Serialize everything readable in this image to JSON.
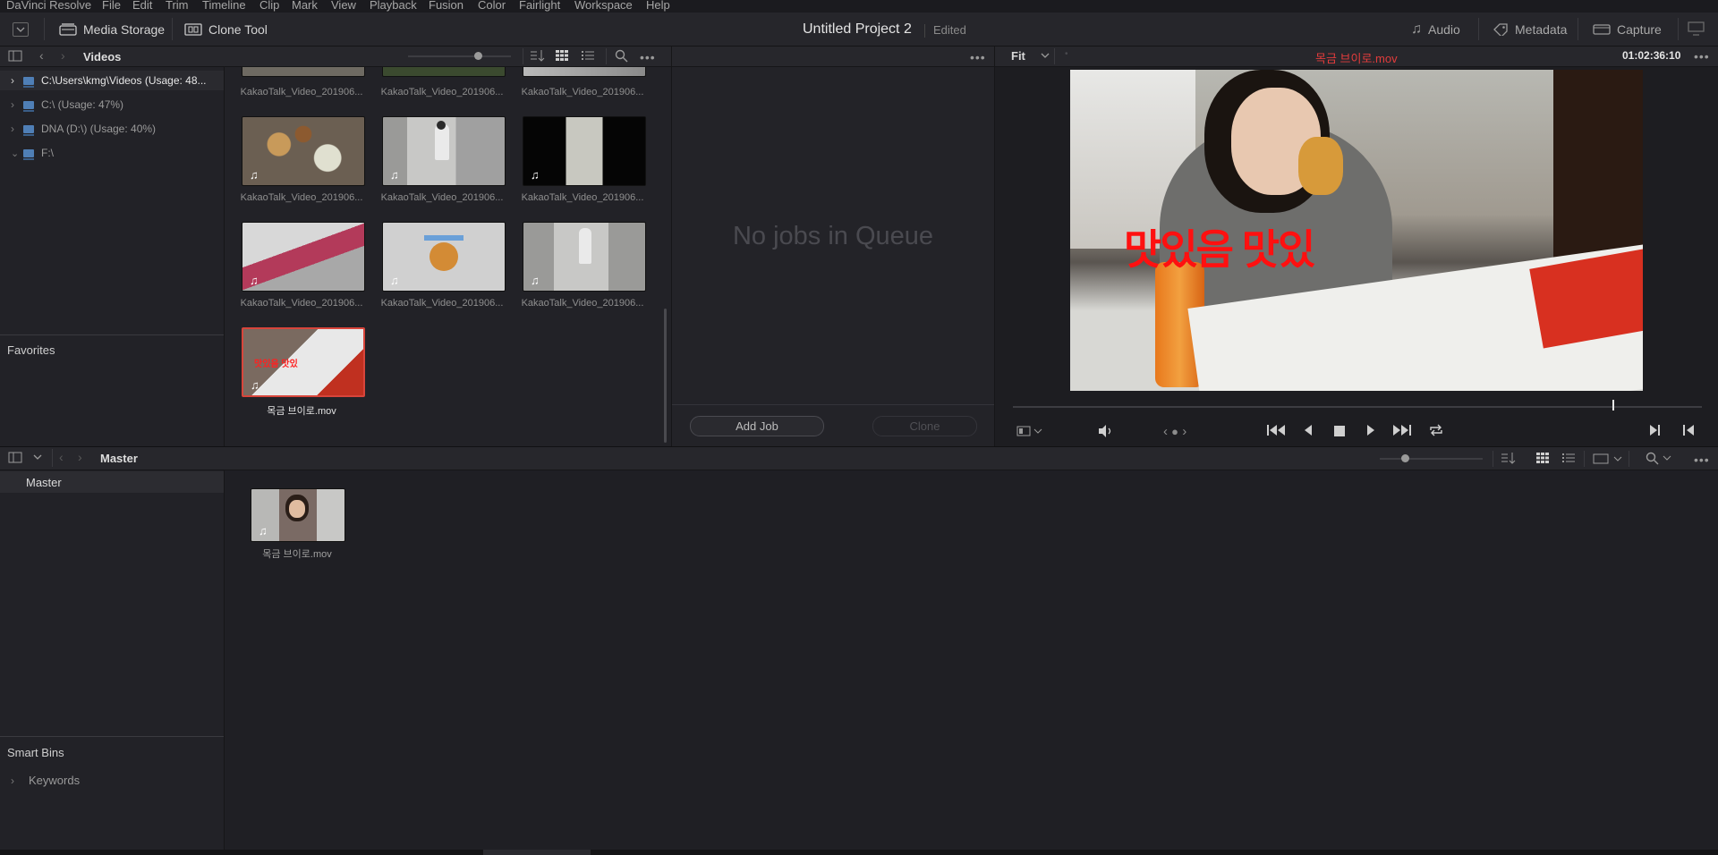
{
  "menu": [
    "DaVinci Resolve",
    "File",
    "Edit",
    "Trim",
    "Timeline",
    "Clip",
    "Mark",
    "View",
    "Playback",
    "Fusion",
    "Color",
    "Fairlight",
    "Workspace",
    "Help"
  ],
  "toolbar": {
    "media_storage": "Media Storage",
    "clone_tool": "Clone Tool",
    "project_title": "Untitled Project 2",
    "project_status": "Edited",
    "audio": "Audio",
    "metadata": "Metadata",
    "capture": "Capture"
  },
  "storage": {
    "title": "Videos",
    "tree": [
      {
        "label": "C:\\Users\\kmg\\Videos (Usage: 48...",
        "expanded": false,
        "selected": true
      },
      {
        "label": "C:\\ (Usage: 47%)",
        "expanded": false,
        "selected": false
      },
      {
        "label": "DNA (D:\\) (Usage: 40%)",
        "expanded": false,
        "selected": false
      },
      {
        "label": "F:\\",
        "expanded": true,
        "selected": false
      }
    ],
    "favorites": "Favorites"
  },
  "media_clips": [
    {
      "name": "KakaoTalk_Video_201906..."
    },
    {
      "name": "KakaoTalk_Video_201906..."
    },
    {
      "name": "KakaoTalk_Video_201906..."
    },
    {
      "name": "KakaoTalk_Video_201906..."
    },
    {
      "name": "KakaoTalk_Video_201906..."
    },
    {
      "name": "KakaoTalk_Video_201906..."
    },
    {
      "name": "KakaoTalk_Video_201906..."
    },
    {
      "name": "KakaoTalk_Video_201906..."
    },
    {
      "name": "KakaoTalk_Video_201906..."
    },
    {
      "name": "목금 브이로.mov",
      "selected": true
    }
  ],
  "clone": {
    "empty_text": "No jobs in Queue",
    "add_job": "Add Job",
    "clone": "Clone"
  },
  "viewer": {
    "zoom": "Fit",
    "clip_name": "목금 브이로.mov",
    "timecode": "01:02:36:10",
    "overlay_text": "맛있음 맛있",
    "playhead": 0.87
  },
  "media_pool": {
    "title": "Master",
    "bins": [
      "Master"
    ],
    "clip_name": "목금 브이로.mov",
    "smart_bins": "Smart Bins",
    "keywords": "Keywords"
  },
  "colors": {
    "accent_red": "#e23c3c",
    "selection": "#d8453b",
    "panel_bg": "#222227"
  },
  "icons": [
    "panel-toggle-icon",
    "chevron-left-icon",
    "chevron-right-icon",
    "sort-icon",
    "grid-view-icon",
    "list-view-icon",
    "search-icon",
    "more-options-icon",
    "speaker-icon",
    "skip-to-start-icon",
    "step-back-icon",
    "stop-icon",
    "play-icon",
    "skip-to-end-icon",
    "loop-icon",
    "music-note-icon",
    "drive-icon"
  ]
}
